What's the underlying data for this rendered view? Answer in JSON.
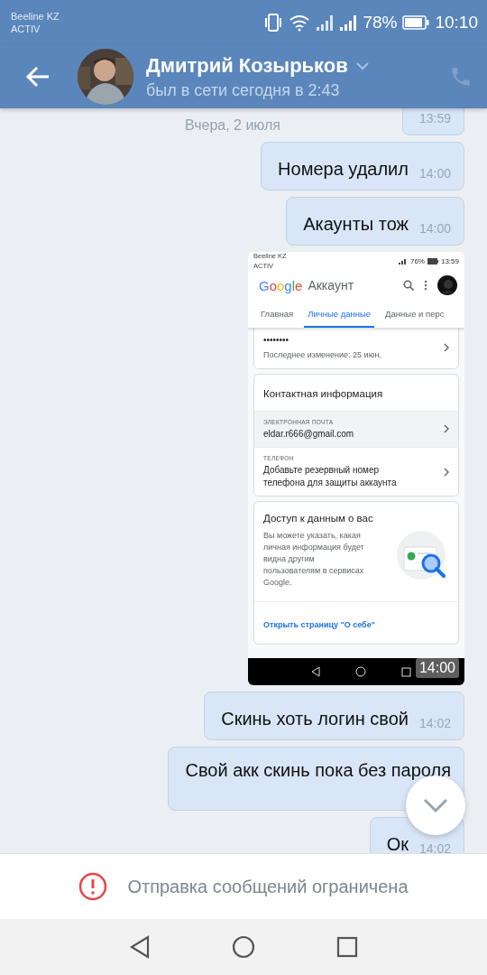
{
  "status_bar": {
    "carrier": [
      "Beeline KZ",
      "ACTIV"
    ],
    "battery": "78%",
    "time": "10:10"
  },
  "header": {
    "name": "Дмитрий Козырьков",
    "status": "был в сети сегодня в 2:43"
  },
  "date_label": "Вчера, 2 июля",
  "messages": [
    {
      "kind": "text",
      "time": "13:59",
      "cut": true
    },
    {
      "kind": "text",
      "text": "Номера удалил",
      "time": "14:00"
    },
    {
      "kind": "text",
      "text": "Акаунты тож",
      "time": "14:00"
    },
    {
      "kind": "screenshot",
      "time": "14:00",
      "screenshot": {
        "status_bar": {
          "carrier": [
            "Beeline KZ",
            "ACTIV"
          ],
          "battery": "76%",
          "time": "13:59"
        },
        "logo": "Google",
        "title": "Аккаунт",
        "tabs": [
          {
            "label": "Главная",
            "selected": false
          },
          {
            "label": "Личные данные",
            "selected": true
          },
          {
            "label": "Данные и перс",
            "selected": false
          }
        ],
        "password": {
          "value": "••••••••",
          "note": "Последнее изменение: 25 июн."
        },
        "contact": {
          "title": "Контактная информация",
          "rows": [
            {
              "label": "ЭЛЕКТРОННАЯ ПОЧТА",
              "value": "eldar.r666@gmail.com",
              "highlighted": true
            },
            {
              "label": "ТЕЛЕФОН",
              "value": "Добавьте резервный номер телефона для защиты аккаунта",
              "highlighted": false
            }
          ]
        },
        "about": {
          "title": "Доступ к данным о вас",
          "text": "Вы можете указать, какая личная информация будет видна другим пользователям в сервисах Google.",
          "link": "Открыть страницу \"О себе\""
        }
      }
    },
    {
      "kind": "text",
      "text": "Скинь хоть логин свой",
      "time": "14:02"
    },
    {
      "kind": "text",
      "text": "Свой акк скинь пока без пароля"
    },
    {
      "kind": "text",
      "text": "Ок",
      "time": "14:02"
    }
  ],
  "restriction": "Отправка сообщений ограничена"
}
